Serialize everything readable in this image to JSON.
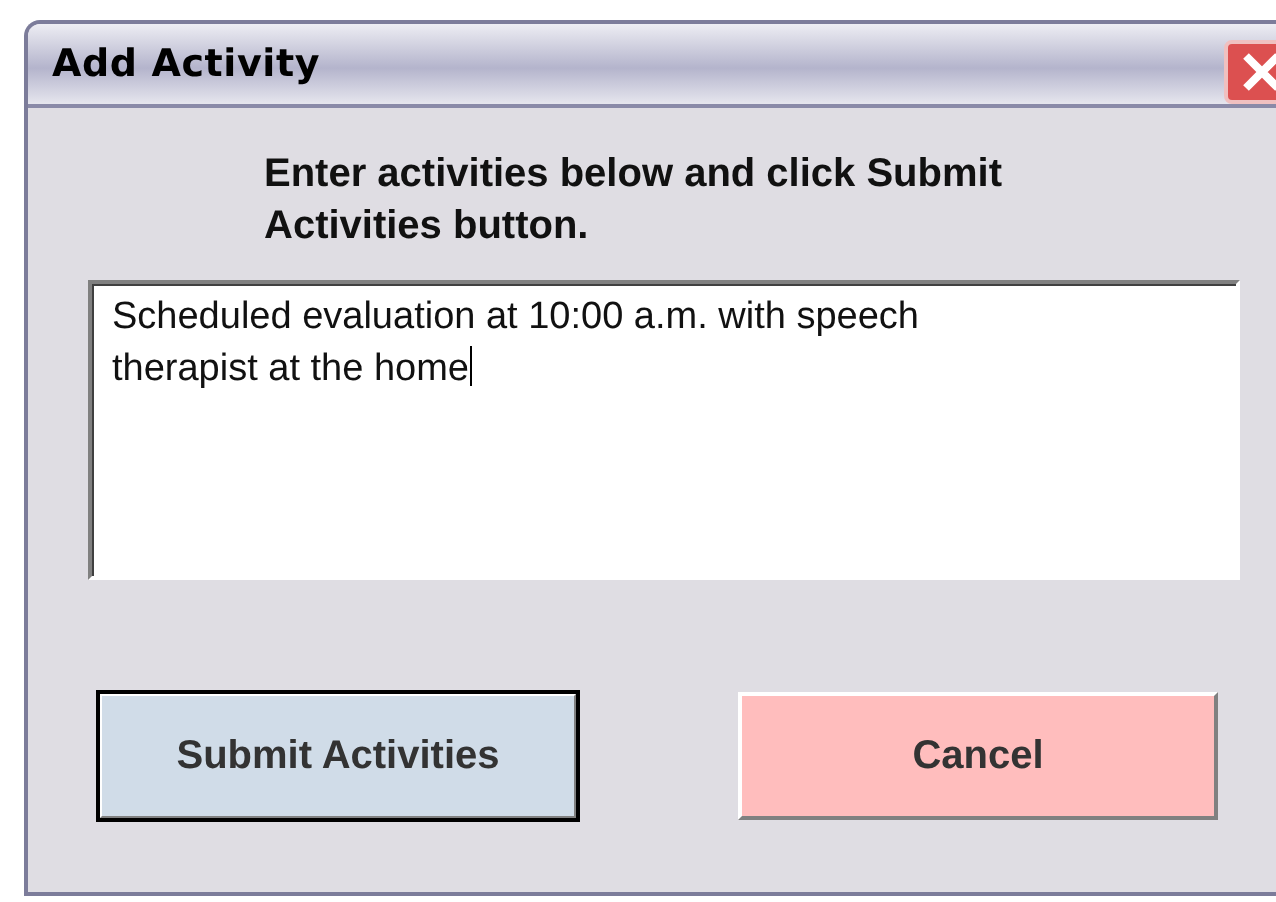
{
  "window": {
    "title": "Add Activity"
  },
  "instruction": "Enter activities below and click Submit Activities button.",
  "activity_text": {
    "value": "Scheduled evaluation at 10:00 a.m. with speech therapist at the home",
    "focused": true
  },
  "buttons": [
    {
      "label": "Submit Activities",
      "default": true,
      "color": "#d0dce8"
    },
    {
      "label": "Cancel",
      "default": false,
      "color": "#ffbdbd"
    }
  ]
}
